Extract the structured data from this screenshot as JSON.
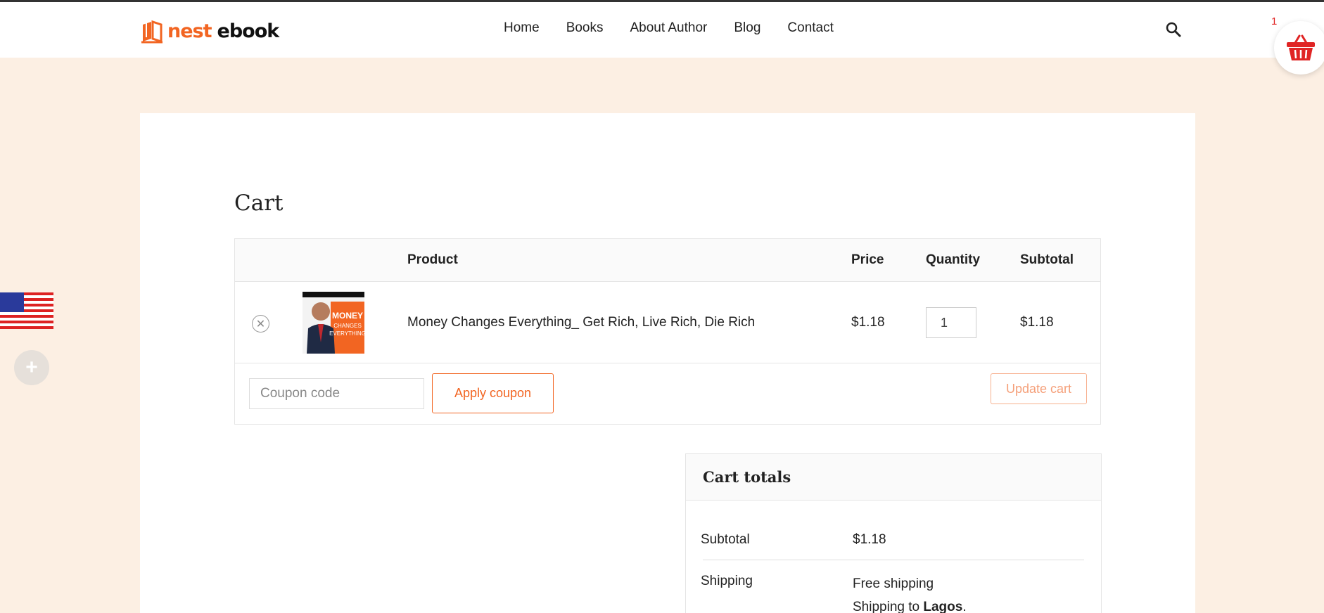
{
  "header": {
    "logo_word1": "nest",
    "logo_word2": "ebook",
    "nav": [
      "Home",
      "Books",
      "About Author",
      "Blog",
      "Contact"
    ],
    "cart_count": "1"
  },
  "page": {
    "title": "Cart"
  },
  "table": {
    "headers": {
      "product": "Product",
      "price": "Price",
      "quantity": "Quantity",
      "subtotal": "Subtotal"
    },
    "rows": [
      {
        "product": "Money Changes Everything_ Get Rich, Live Rich, Die Rich",
        "price": "$1.18",
        "quantity": "1",
        "subtotal": "$1.18",
        "thumb_text": "MONEY CHANGES EVERYTHING"
      }
    ]
  },
  "actions": {
    "coupon_placeholder": "Coupon code",
    "apply_label": "Apply coupon",
    "update_label": "Update cart"
  },
  "totals": {
    "title": "Cart totals",
    "subtotal_label": "Subtotal",
    "subtotal_value": "$1.18",
    "shipping_label": "Shipping",
    "shipping_method": "Free shipping",
    "shipping_to_prefix": "Shipping to ",
    "shipping_to_place": "Lagos",
    "shipping_to_suffix": "."
  },
  "colors": {
    "accent": "#f26522",
    "background": "#fcefe3",
    "cart_icon": "#e02424"
  },
  "icons": {
    "search": "search-icon",
    "cart": "basket-icon",
    "remove": "close-circle-icon",
    "flag": "us-flag-icon",
    "plus": "plus-icon"
  }
}
